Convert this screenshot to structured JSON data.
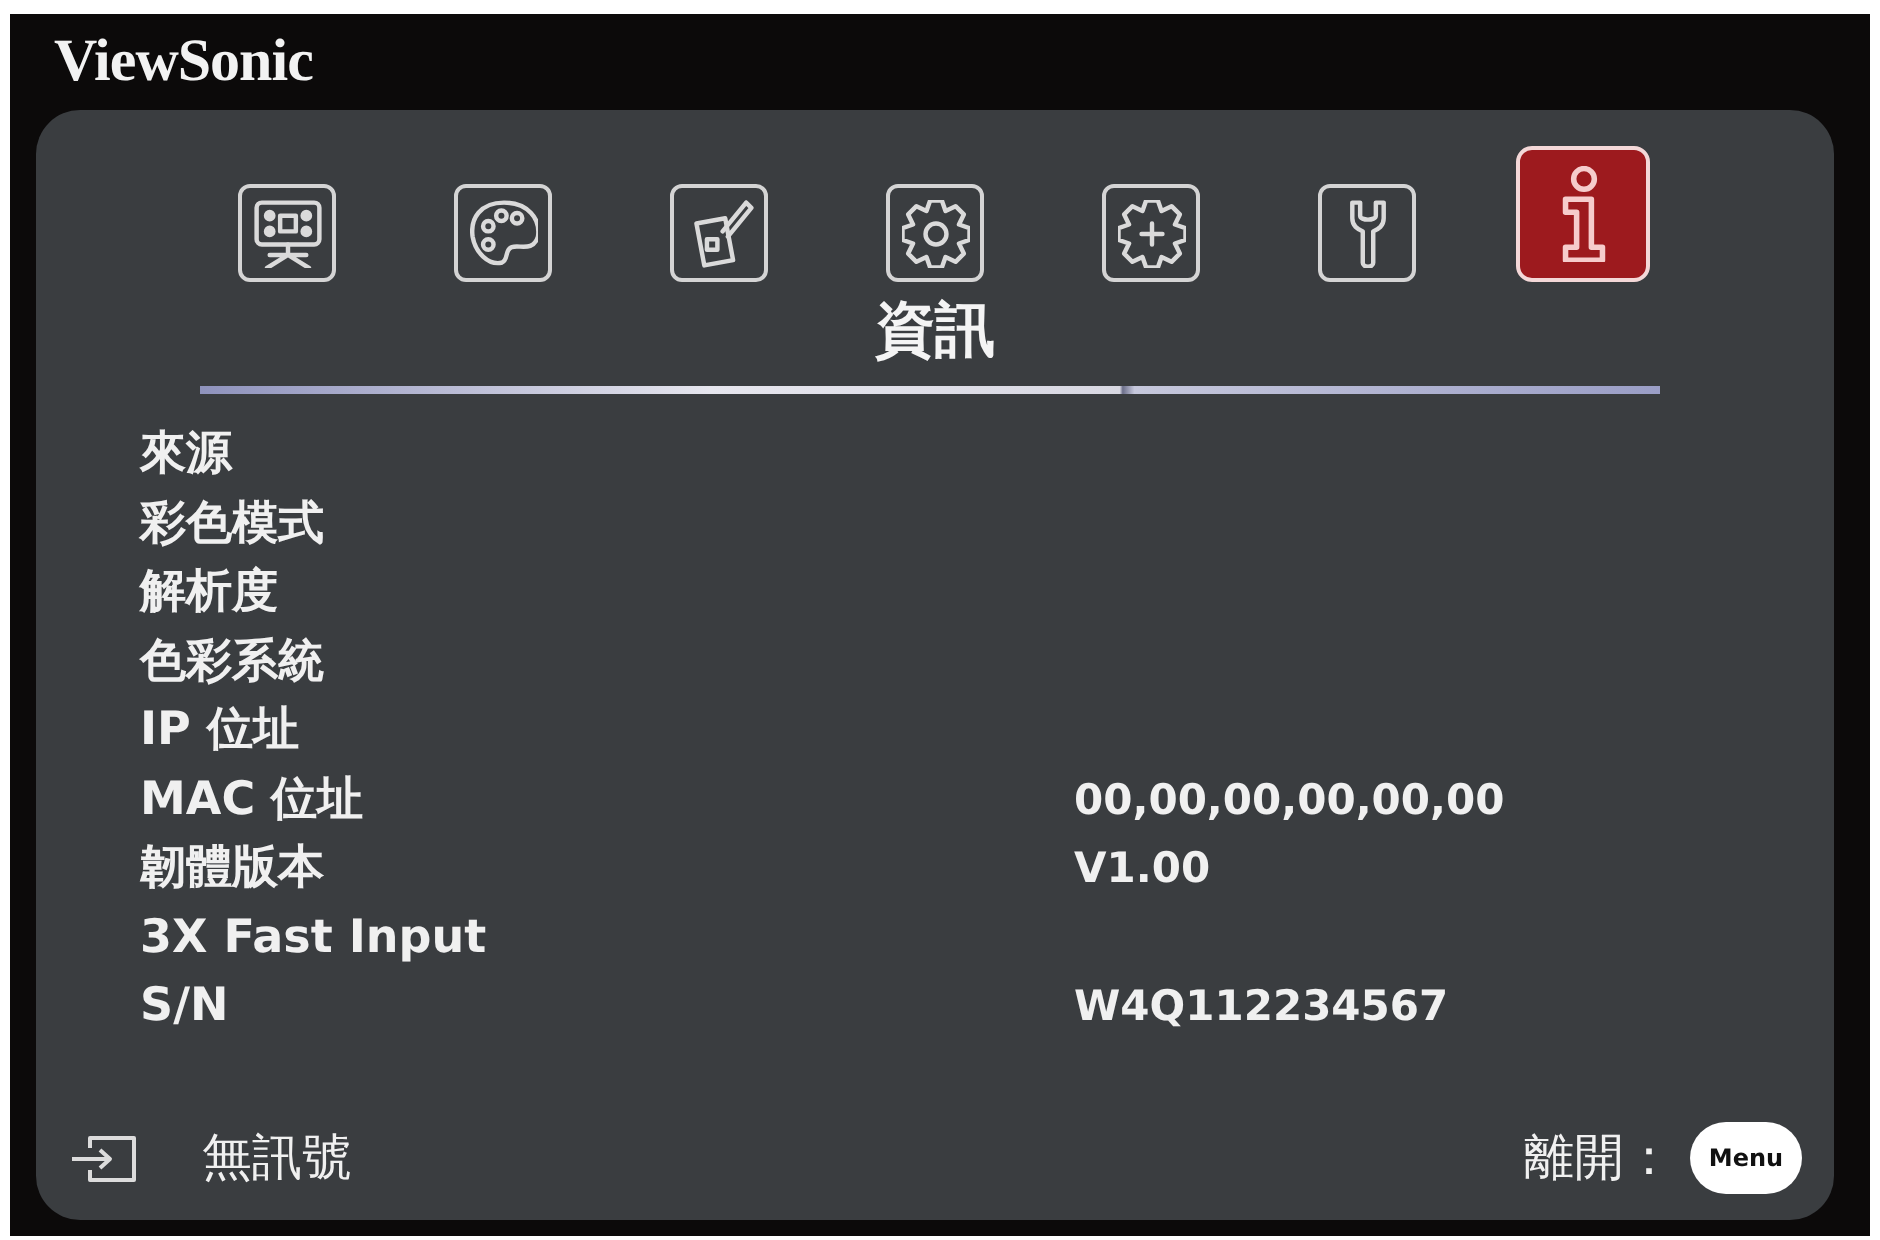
{
  "window": {
    "brand": "ViewSonic"
  },
  "tabs": [
    {
      "kind": "screen",
      "selected": false
    },
    {
      "kind": "palette",
      "selected": false
    },
    {
      "kind": "device",
      "selected": false
    },
    {
      "kind": "gear",
      "selected": false
    },
    {
      "kind": "gear_plus",
      "selected": false
    },
    {
      "kind": "wrench",
      "selected": false
    },
    {
      "kind": "info",
      "selected": true
    }
  ],
  "menu_title": "資訊",
  "rows": [
    {
      "label": "來源"
    },
    {
      "label": "彩色模式"
    },
    {
      "label": "解析度"
    },
    {
      "label": "色彩系統"
    },
    {
      "label": "IP 位址"
    },
    {
      "label": "MAC 位址",
      "value": "00,00,00,00,00,00"
    },
    {
      "label": "韌體版本",
      "value": "V1.00"
    },
    {
      "label": "3X Fast Input"
    },
    {
      "label": "S/N",
      "value": "W4Q112234567"
    }
  ],
  "status_bar": {
    "source_status": "無訊號",
    "exit_label": "離開：",
    "exit_key": "Menu"
  }
}
